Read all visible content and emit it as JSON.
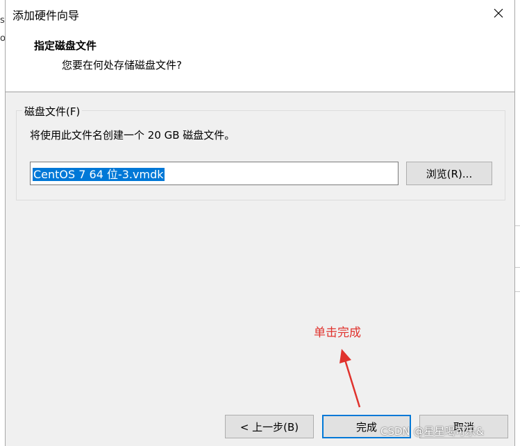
{
  "dialog": {
    "title": "添加硬件向导"
  },
  "header": {
    "title": "指定磁盘文件",
    "subtitle": "您要在何处存储磁盘文件?"
  },
  "disk_file": {
    "group_label": "磁盘文件(F)",
    "description": "将使用此文件名创建一个 20 GB 磁盘文件。",
    "filename_value": "CentOS 7 64 位-3.vmdk",
    "browse_label": "浏览(R)..."
  },
  "footer": {
    "back_label": "< 上一步(B)",
    "finish_label": "完成",
    "cancel_label": "取消"
  },
  "annotation": {
    "text": "单击完成",
    "color": "#e0322d"
  },
  "watermark": {
    "text": "CSDN @星星喝可乐&"
  },
  "edge_fragments": {
    "left_top": "s",
    "left_mid": "o"
  },
  "colors": {
    "accent": "#0078d7"
  }
}
